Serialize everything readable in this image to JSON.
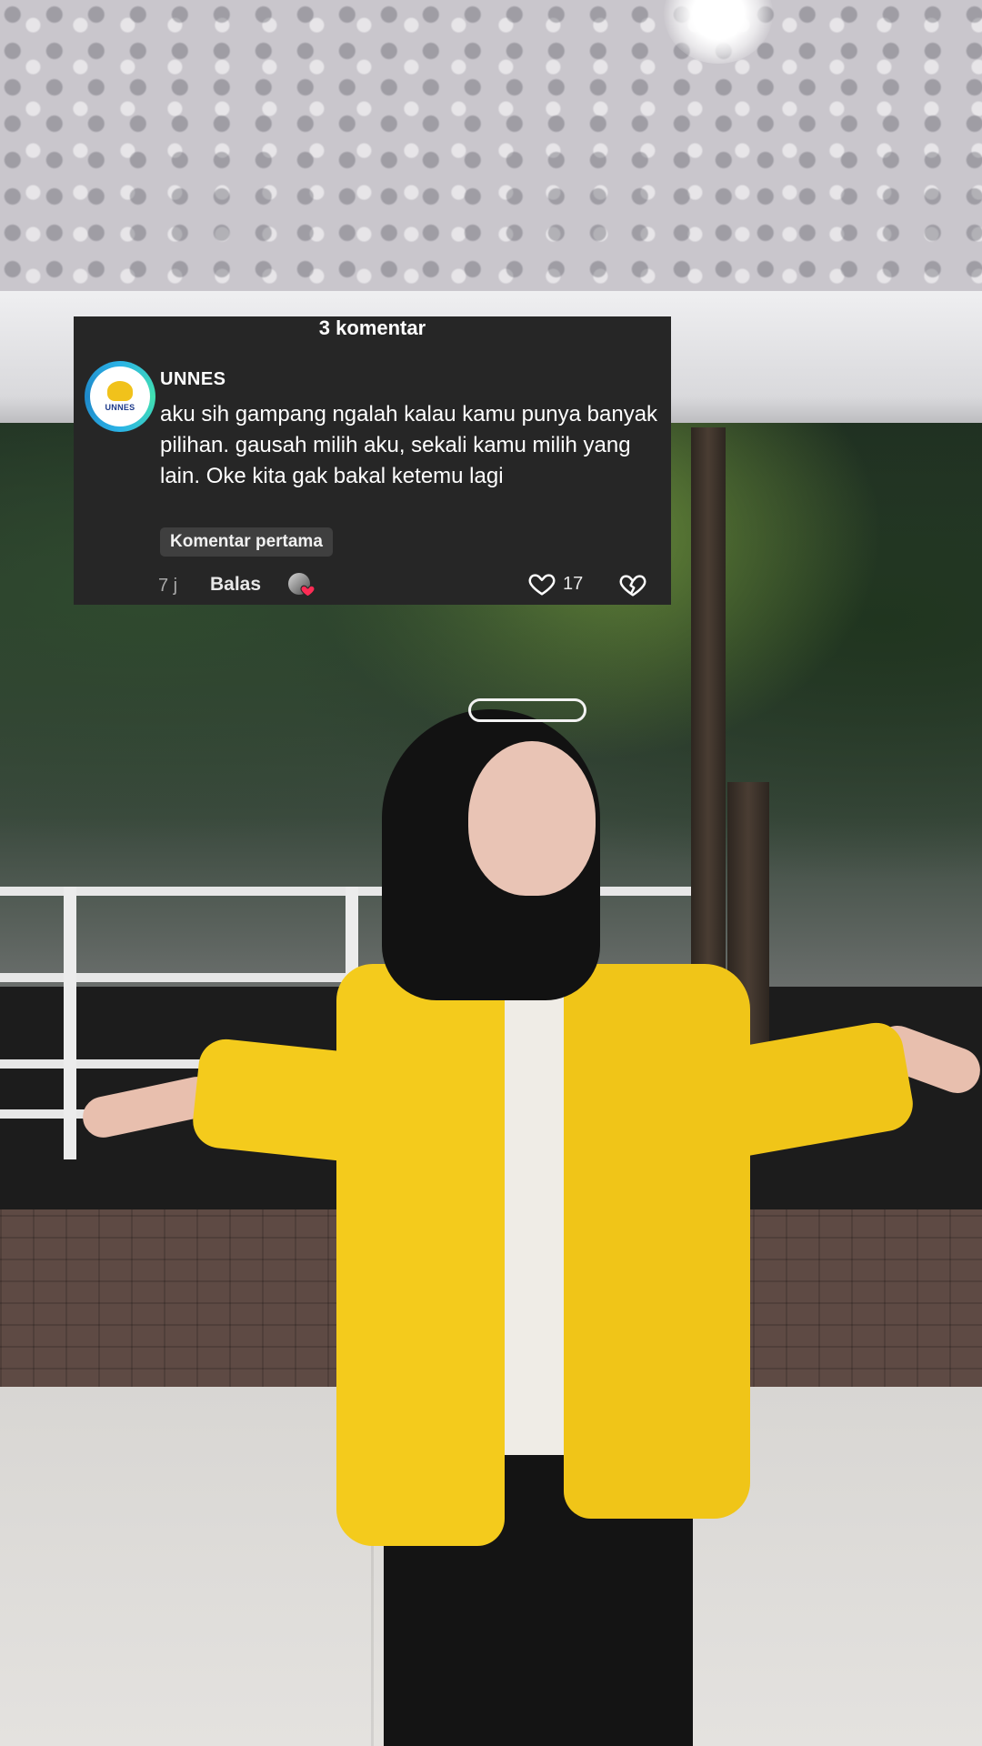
{
  "comments_header": {
    "count_label": "3 komentar"
  },
  "comment": {
    "avatar_text": "UNNES",
    "username": "UNNES",
    "text": "aku sih gampang ngalah kalau kamu punya banyak pilihan. gausah milih aku, sekali kamu milih yang lain. Oke kita gak bakal ketemu lagi",
    "badge": "Komentar pertama",
    "time": "7 j",
    "reply_label": "Balas",
    "like_count": "17",
    "icons": {
      "like": "heart-outline-icon",
      "dislike": "broken-heart-icon",
      "reactor_badge": "heart-icon"
    },
    "colors": {
      "card_bg": "#262626",
      "badge_bg": "#3f3f3f",
      "heart_red": "#fe2c55",
      "avatar_ring": "#2bb3e6"
    }
  }
}
